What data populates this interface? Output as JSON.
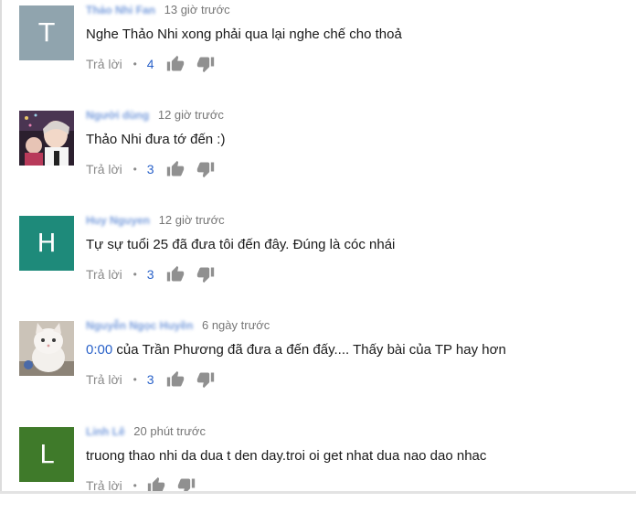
{
  "comments": [
    {
      "avatar_letter": "T",
      "avatar_color": "#90a4ae",
      "author": "Thảo Nhi Fan",
      "time": "13 giờ trước",
      "text": "Nghe Thảo Nhi xong phải qua lại nghe chế cho thoả",
      "reply_label": "Trả lời",
      "likes": "4"
    },
    {
      "avatar_letter": "",
      "avatar_color": "#3a2a3a",
      "author": "Người dùng",
      "time": "12 giờ trước",
      "text": "Thảo Nhi đưa tớ đến :)",
      "reply_label": "Trả lời",
      "likes": "3"
    },
    {
      "avatar_letter": "H",
      "avatar_color": "#1e8a7a",
      "author": "Huy Nguyen",
      "time": "12 giờ trước",
      "text": "Tự sự tuổi 25 đã đưa tôi đến đây. Đúng là cóc nhái",
      "reply_label": "Trả lời",
      "likes": "3"
    },
    {
      "avatar_letter": "",
      "avatar_color": "#c9bfb2",
      "author": "Nguyễn Ngọc Huyền",
      "time": "6 ngày trước",
      "timestamp": "0:00",
      "text": " của Trần Phương đã đưa a đến đấy.... Thấy bài của TP hay hơn",
      "reply_label": "Trả lời",
      "likes": "3"
    },
    {
      "avatar_letter": "L",
      "avatar_color": "#3f7a2a",
      "author": "Linh Lê",
      "time": "20 phút trước",
      "text": "truong thao nhi da dua t den day.troi oi get nhat dua nao dao nhac",
      "reply_label": "Trả lời",
      "likes": ""
    }
  ]
}
